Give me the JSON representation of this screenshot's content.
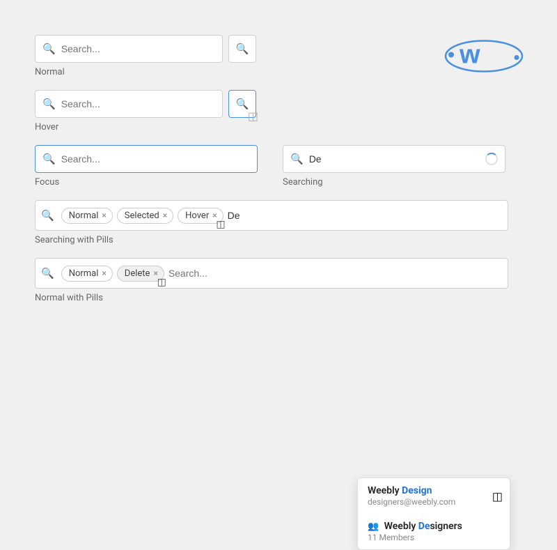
{
  "logo": {
    "alt": "Weebly logo"
  },
  "sections": [
    {
      "id": "normal",
      "label": "Normal",
      "type": "single",
      "input_placeholder": "Search...",
      "show_button": true,
      "button_hovered": false
    },
    {
      "id": "hover",
      "label": "Hover",
      "type": "single",
      "input_placeholder": "Search...",
      "show_button": true,
      "button_hovered": true
    },
    {
      "id": "focus-searching",
      "label_left": "Focus",
      "label_right": "Searching",
      "type": "double",
      "left": {
        "input_placeholder": "Search...",
        "focused": true,
        "value": ""
      },
      "right": {
        "input_placeholder": "",
        "searching": true,
        "value": "De"
      }
    },
    {
      "id": "searching-pills",
      "label": "Searching with Pills",
      "type": "pills-search",
      "pills": [
        {
          "label": "Normal",
          "id": "pill-normal"
        },
        {
          "label": "Selected",
          "id": "pill-selected"
        },
        {
          "label": "Hover",
          "id": "pill-hover",
          "cursor": true
        }
      ],
      "input_value": "De",
      "dropdown": {
        "items": [
          {
            "type": "user",
            "title_prefix": "Weebly ",
            "title_bold": "Design",
            "subtitle": "designers@weebly.com",
            "has_cursor": true
          },
          {
            "type": "group",
            "title_prefix": "Weebly ",
            "title_bold": "De",
            "title_suffix": "signers",
            "subtitle": "11 Members"
          }
        ]
      }
    },
    {
      "id": "normal-pills",
      "label": "Normal with Pills",
      "type": "pills-normal",
      "pills": [
        {
          "label": "Normal",
          "id": "pill-n1"
        },
        {
          "label": "Delete",
          "id": "pill-n2",
          "delete": true,
          "cursor": true
        }
      ],
      "input_placeholder": "Search..."
    }
  ]
}
